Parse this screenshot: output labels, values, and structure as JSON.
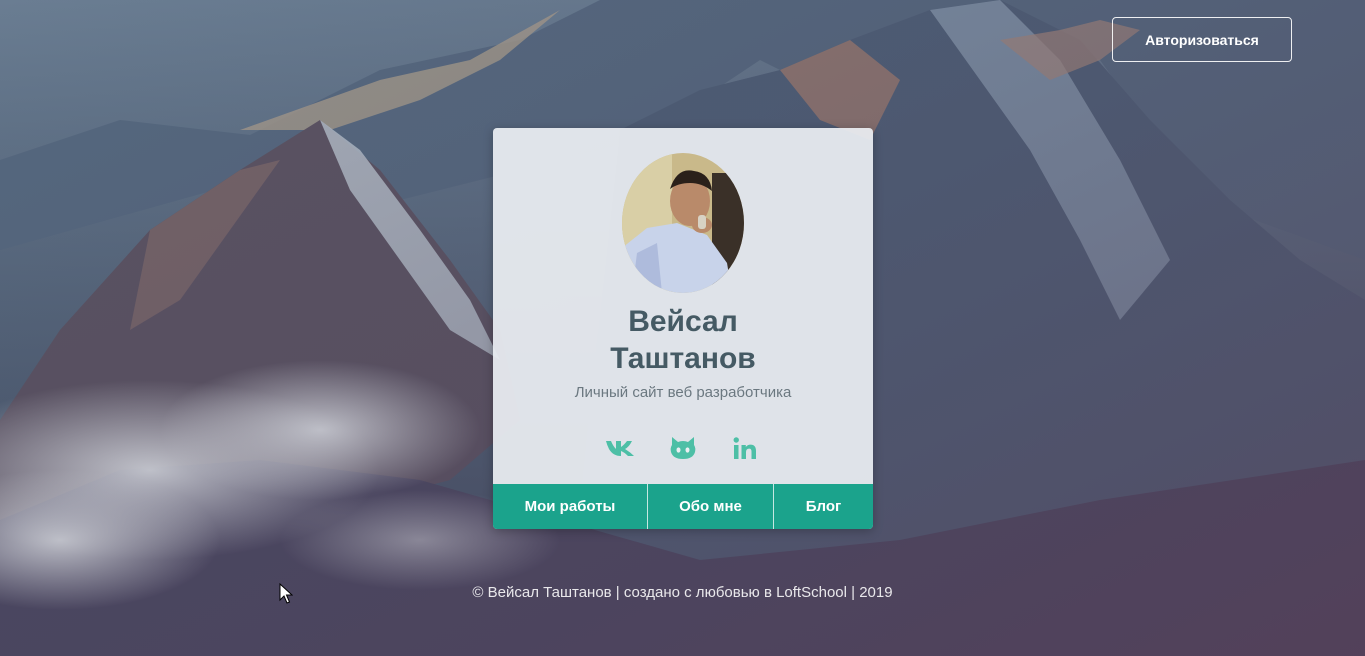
{
  "header": {
    "auth_label": "Авторизоваться"
  },
  "card": {
    "name_line1": "Вейсал",
    "name_line2": "Таштанов",
    "subtitle": "Личный сайт веб разработчика",
    "socials": [
      {
        "icon": "vk-icon"
      },
      {
        "icon": "github-icon"
      },
      {
        "icon": "linkedin-icon"
      }
    ],
    "nav": [
      {
        "label": "Мои работы"
      },
      {
        "label": "Обо мне"
      },
      {
        "label": "Блог"
      }
    ]
  },
  "footer": {
    "text": "© Вейсал Таштанов | создано с любовью в LoftSchool | 2019"
  },
  "colors": {
    "accent": "#1ba38c",
    "social_icon": "#4dbfa6",
    "name_text": "#455a64"
  }
}
